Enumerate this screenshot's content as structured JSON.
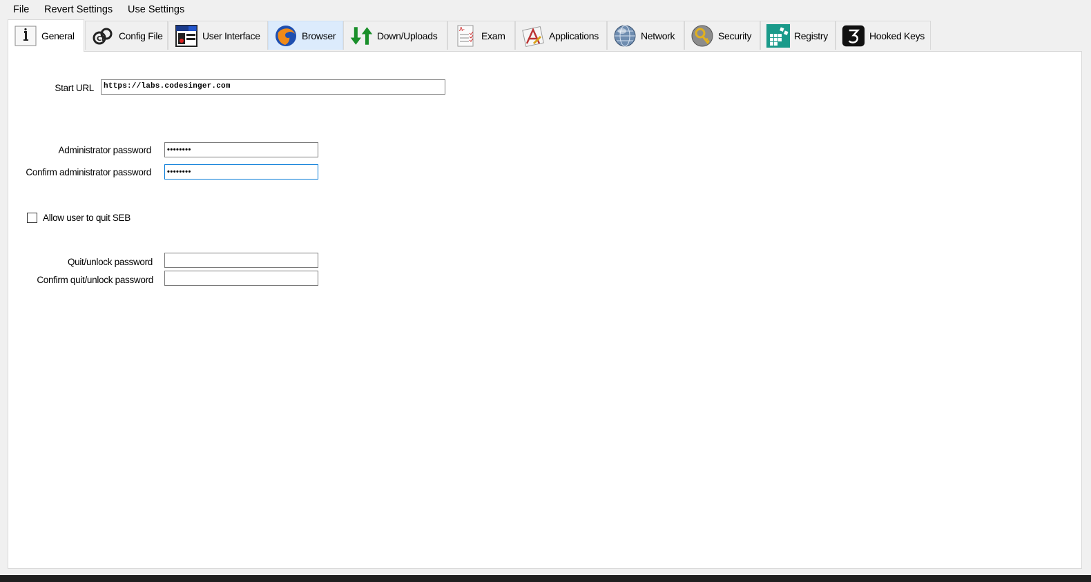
{
  "menu": {
    "file": "File",
    "revert": "Revert Settings",
    "use": "Use Settings"
  },
  "tabs": [
    {
      "label": "General",
      "icon": "general-info-icon"
    },
    {
      "label": "Config File",
      "icon": "config-file-icon"
    },
    {
      "label": "User Interface",
      "icon": "user-interface-icon"
    },
    {
      "label": "Browser",
      "icon": "browser-icon"
    },
    {
      "label": "Down/Uploads",
      "icon": "down-uploads-icon"
    },
    {
      "label": "Exam",
      "icon": "exam-icon"
    },
    {
      "label": "Applications",
      "icon": "applications-icon"
    },
    {
      "label": "Network",
      "icon": "network-icon"
    },
    {
      "label": "Security",
      "icon": "security-icon"
    },
    {
      "label": "Registry",
      "icon": "registry-icon"
    },
    {
      "label": "Hooked Keys",
      "icon": "hooked-keys-icon"
    }
  ],
  "selected_tab": "General",
  "general": {
    "start_url_label": "Start URL",
    "start_url_value": "https://labs.codesinger.com",
    "admin_pw_label": "Administrator password",
    "admin_pw_value": "••••••••",
    "confirm_admin_pw_label": "Confirm administrator password",
    "confirm_admin_pw_value": "••••••••",
    "allow_quit_label": "Allow user to quit SEB",
    "allow_quit_checked": false,
    "quit_pw_label": "Quit/unlock password",
    "quit_pw_value": "",
    "confirm_quit_pw_label": "Confirm quit/unlock password",
    "confirm_quit_pw_value": ""
  },
  "colors": {
    "focus_border": "#0078d7",
    "tab_hover": "#dcebfc",
    "registry_icon": "#1a9a8a",
    "down_arrow": "#1a8f2a"
  }
}
